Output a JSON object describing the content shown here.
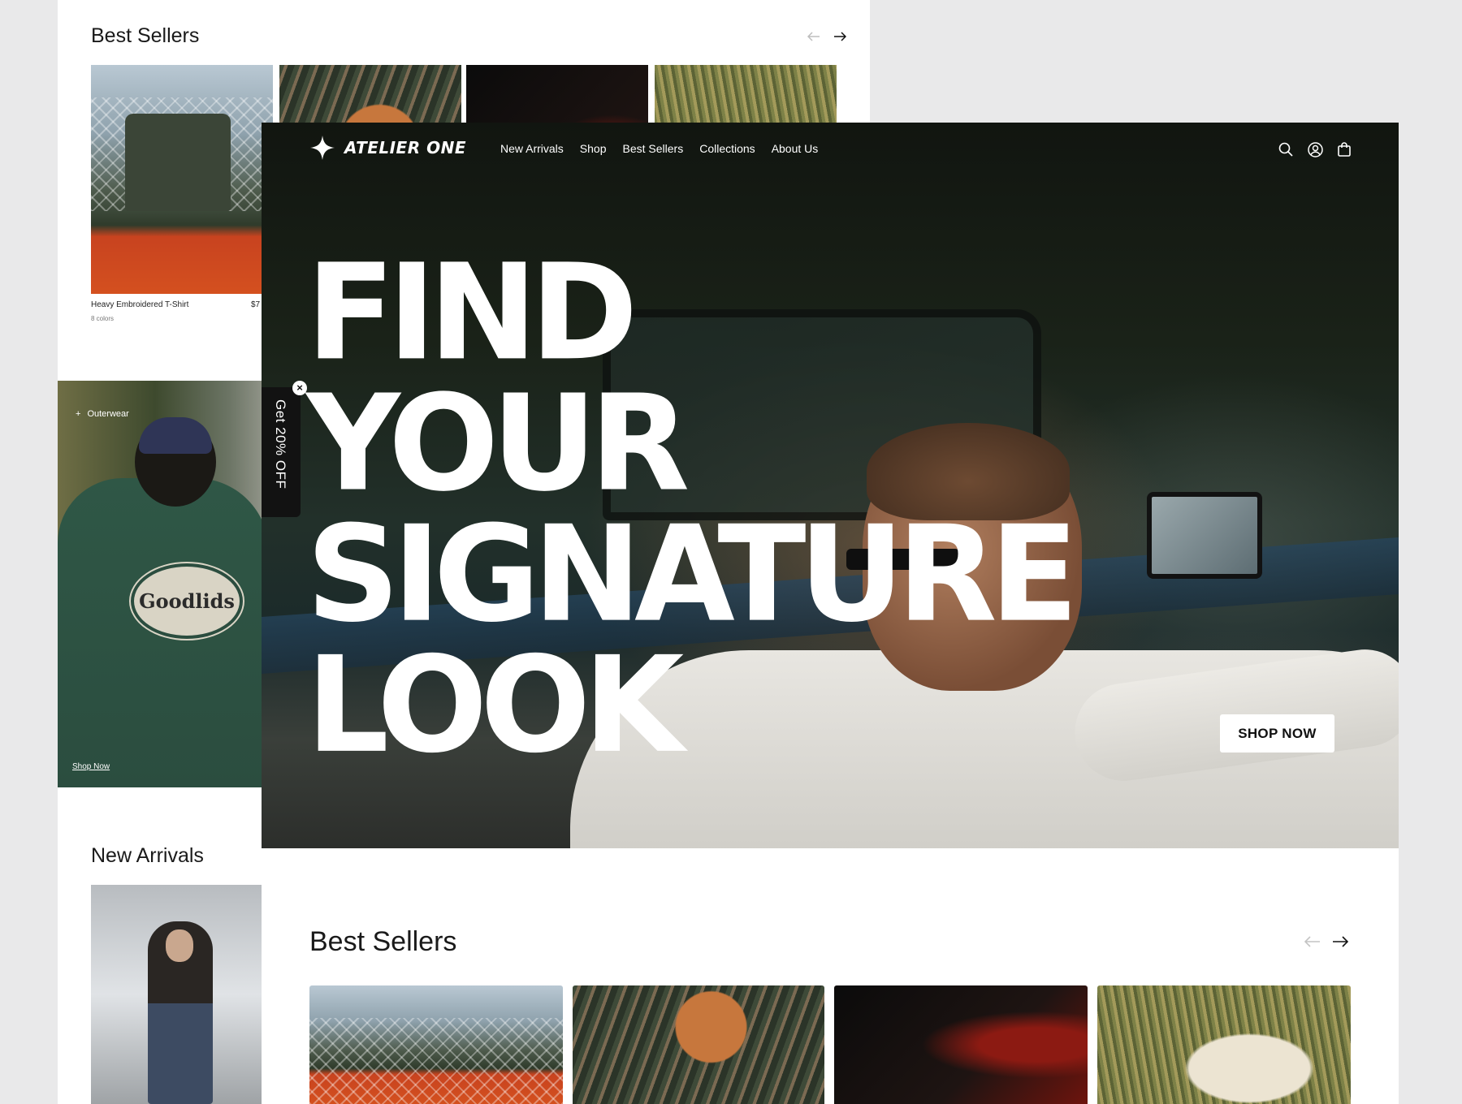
{
  "background_page": {
    "best_sellers_title": "Best Sellers",
    "product": {
      "name": "Heavy Embroidered T-Shirt",
      "colors": "8 colors",
      "price": "$7"
    },
    "banner": {
      "tag": "Outerwear",
      "link": "Shop Now",
      "shirt_logo": "Goodlids"
    },
    "new_arrivals_title": "New Arrivals"
  },
  "nav": {
    "brand": "ATELIER ONE",
    "links": [
      "New Arrivals",
      "Shop",
      "Best Sellers",
      "Collections",
      "About Us"
    ],
    "icons": [
      "search-icon",
      "account-icon",
      "bag-icon"
    ]
  },
  "hero": {
    "headline_lines": [
      "FIND",
      "YOUR",
      "SIGNATURE",
      "LOOK"
    ],
    "cta": "SHOP NOW"
  },
  "promo": {
    "label": "Get 20% OFF",
    "close": "×"
  },
  "best_sellers": {
    "title": "Best Sellers"
  },
  "colors": {
    "hero_text": "#ffffff",
    "promo_bg": "#121212",
    "page_bg": "#e9e9ea"
  }
}
